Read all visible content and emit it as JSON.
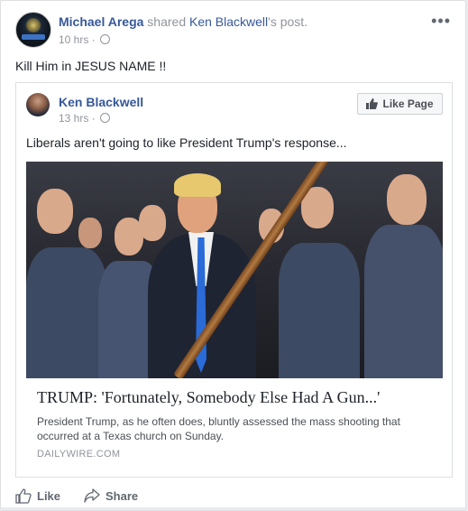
{
  "post": {
    "author": "Michael Arega",
    "shared_text": " shared ",
    "shared_of": "Ken Blackwell",
    "shared_suffix": "'s post.",
    "time": "10 hrs",
    "menu": "•••",
    "status": "Kill Him in JESUS NAME !!"
  },
  "shared_post": {
    "author": "Ken Blackwell",
    "time": "13 hrs",
    "like_page_label": "Like Page",
    "status": "Liberals aren't going to like President Trump's response...",
    "link": {
      "title": "TRUMP: 'Fortunately, Somebody Else Had A Gun...'",
      "description": "President Trump, as he often does, bluntly assessed the mass shooting that occurred at a Texas church on Sunday.",
      "domain": "DAILYWIRE.COM"
    }
  },
  "actions": {
    "like": "Like",
    "share": "Share"
  },
  "icons": {
    "globe": "globe-icon",
    "thumbs_up": "thumbs-up-icon",
    "share": "share-arrow-icon",
    "menu": "more-options-icon"
  },
  "colors": {
    "link_blue": "#365899",
    "muted": "#90949c",
    "tie_blue": "#2a6bd8"
  }
}
